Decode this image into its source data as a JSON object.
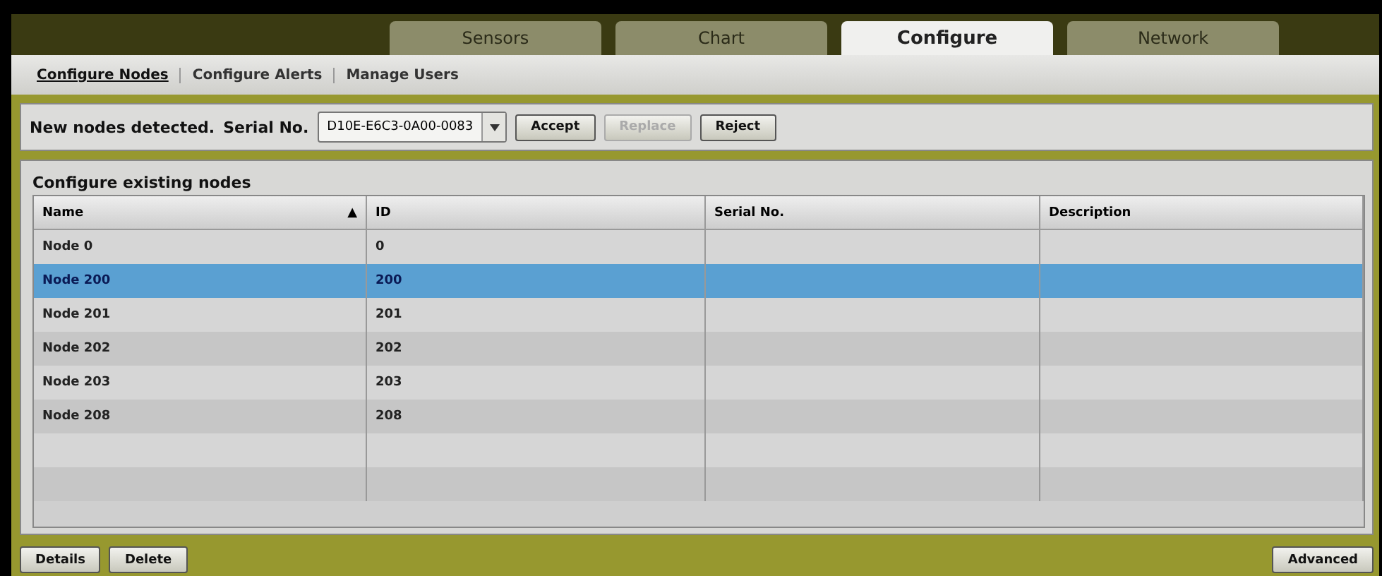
{
  "tabs": [
    {
      "label": "Sensors",
      "selected": false
    },
    {
      "label": "Chart",
      "selected": false
    },
    {
      "label": "Configure",
      "selected": true
    },
    {
      "label": "Network",
      "selected": false
    }
  ],
  "subnav": [
    {
      "label": "Configure Nodes",
      "selected": true
    },
    {
      "label": "Configure Alerts",
      "selected": false
    },
    {
      "label": "Manage Users",
      "selected": false
    }
  ],
  "detection": {
    "message": "New nodes detected.",
    "serial_label": "Serial No.",
    "serial_value": "D10E-E6C3-0A00-0083",
    "buttons": [
      {
        "label": "Accept",
        "disabled": false
      },
      {
        "label": "Replace",
        "disabled": true
      },
      {
        "label": "Reject",
        "disabled": false
      }
    ]
  },
  "table": {
    "title": "Configure existing nodes",
    "columns": [
      {
        "label": "Name",
        "sorted": true
      },
      {
        "label": "ID",
        "sorted": false
      },
      {
        "label": "Serial No.",
        "sorted": false
      },
      {
        "label": "Description",
        "sorted": false
      }
    ],
    "sort_indicator": "▲",
    "rows": [
      {
        "name": "Node 0",
        "id": "0",
        "selected": false
      },
      {
        "name": "Node 200",
        "id": "200",
        "selected": true
      },
      {
        "name": "Node 201",
        "id": "201",
        "selected": false
      },
      {
        "name": "Node 202",
        "id": "202",
        "selected": false
      },
      {
        "name": "Node 203",
        "id": "203",
        "selected": false
      },
      {
        "name": "Node 208",
        "id": "208",
        "selected": false
      }
    ]
  },
  "footer": {
    "left_buttons": [
      "Details",
      "Delete"
    ],
    "right_buttons": [
      "Advanced"
    ]
  }
}
